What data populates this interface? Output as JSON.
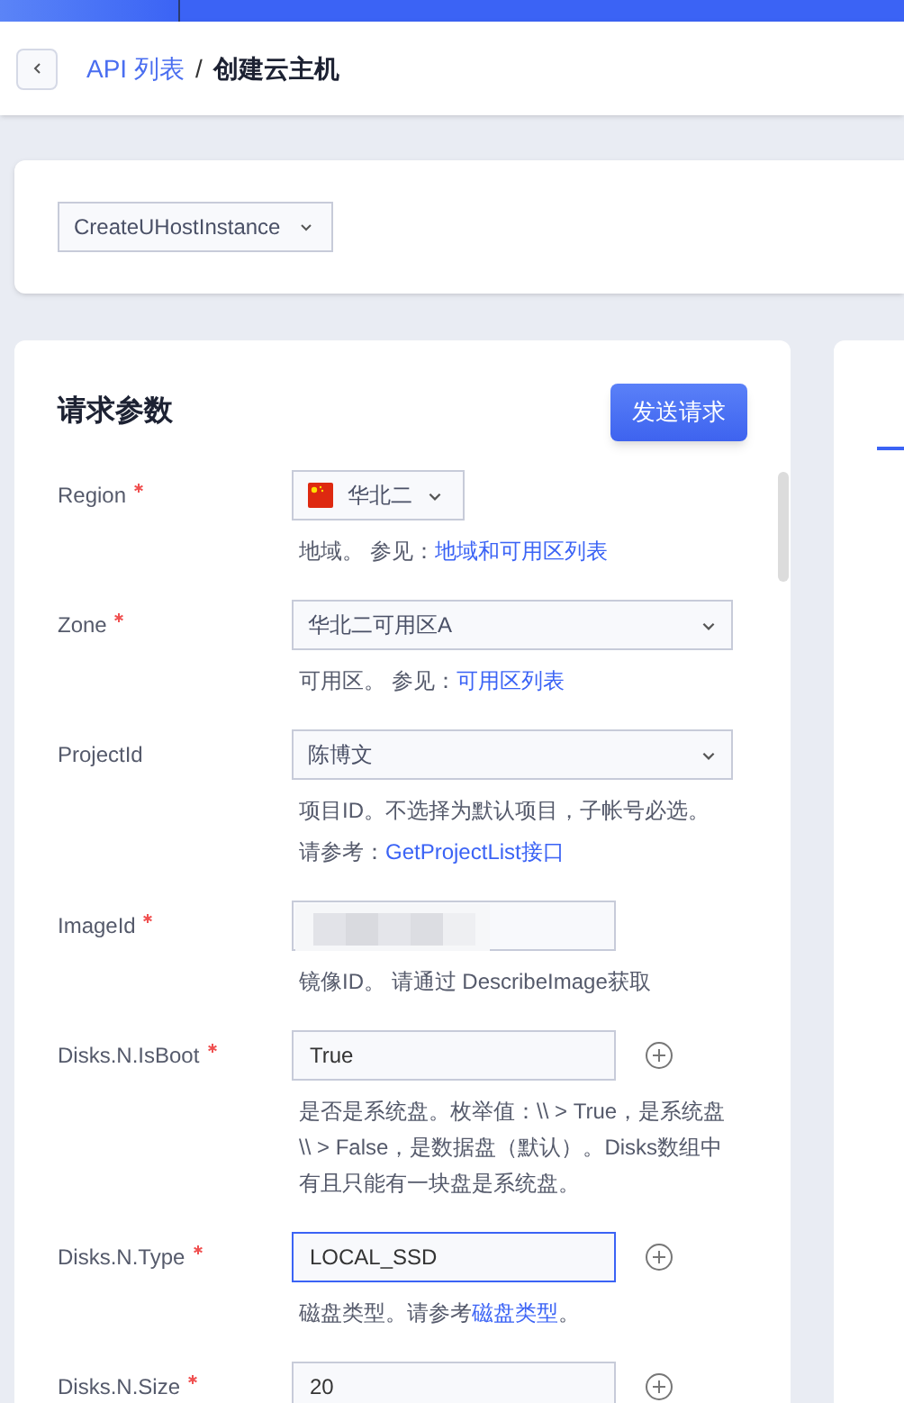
{
  "breadcrumb": {
    "parent": "API 列表",
    "separator": "/",
    "current": "创建云主机"
  },
  "action_select": {
    "value": "CreateUHostInstance"
  },
  "request_params": {
    "title": "请求参数",
    "send_button": "发送请求",
    "fields": [
      {
        "label": "Region",
        "required": true,
        "kind": "flag-select",
        "value": "华北二",
        "focused": false,
        "add_button": false,
        "redacted": false,
        "help": [
          [
            {
              "text": "地域。 参见：",
              "kind": "text"
            },
            {
              "text": "地域和可用区列表",
              "kind": "link"
            }
          ]
        ]
      },
      {
        "label": "Zone",
        "required": true,
        "kind": "select",
        "value": "华北二可用区A",
        "focused": false,
        "add_button": false,
        "redacted": false,
        "help": [
          [
            {
              "text": "可用区。 参见：",
              "kind": "text"
            },
            {
              "text": "可用区列表",
              "kind": "link"
            }
          ]
        ]
      },
      {
        "label": "ProjectId",
        "required": false,
        "kind": "select",
        "value": "陈博文",
        "focused": false,
        "add_button": false,
        "redacted": false,
        "help": [
          [
            {
              "text": "项目ID。不选择为默认项目，子帐号必选。",
              "kind": "text"
            }
          ],
          [
            {
              "text": "请参考：",
              "kind": "text"
            },
            {
              "text": "GetProjectList接口",
              "kind": "link"
            }
          ]
        ]
      },
      {
        "label": "ImageId",
        "required": true,
        "kind": "input",
        "focused": false,
        "add_button": false,
        "redacted": true,
        "help": [
          [
            {
              "text": "镜像ID。 请通过 DescribeImage获取",
              "kind": "text"
            }
          ]
        ]
      },
      {
        "label": "Disks.N.IsBoot",
        "required": true,
        "kind": "input",
        "value": "True",
        "focused": false,
        "add_button": true,
        "redacted": false,
        "help": [
          [
            {
              "text": "是否是系统盘。枚举值：\\\\ > True，是系统盘 \\\\ > False，是数据盘（默认）。Disks数组中有且只能有一块盘是系统盘。",
              "kind": "text"
            }
          ]
        ]
      },
      {
        "label": "Disks.N.Type",
        "required": true,
        "kind": "input",
        "value": "LOCAL_SSD",
        "focused": true,
        "add_button": true,
        "redacted": false,
        "help": [
          [
            {
              "text": "磁盘类型。请参考",
              "kind": "text"
            },
            {
              "text": "磁盘类型",
              "kind": "link"
            },
            {
              "text": "。",
              "kind": "text"
            }
          ]
        ]
      },
      {
        "label": "Disks.N.Size",
        "required": true,
        "kind": "input",
        "value": "20",
        "focused": false,
        "add_button": true,
        "redacted": false
      }
    ]
  }
}
